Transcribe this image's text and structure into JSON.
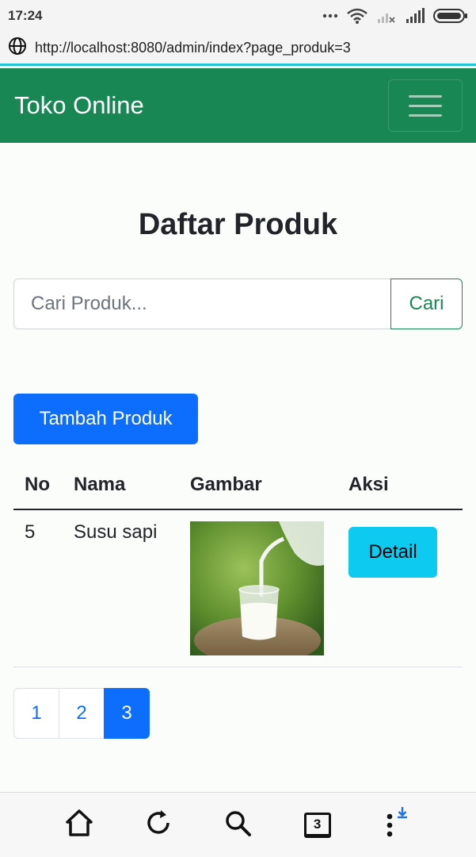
{
  "status_bar": {
    "time": "17:24"
  },
  "browser": {
    "url": "http://localhost:8080/admin/index?page_produk=3",
    "tab_count": "3"
  },
  "navbar": {
    "brand": "Toko Online"
  },
  "page": {
    "title": "Daftar Produk",
    "search": {
      "placeholder": "Cari Produk...",
      "value": "",
      "button_label": "Cari"
    },
    "add_button_label": "Tambah Produk",
    "table": {
      "headers": [
        "No",
        "Nama",
        "Gambar",
        "Aksi"
      ],
      "rows": [
        {
          "no": "5",
          "nama": "Susu sapi",
          "gambar": "milk-pouring-into-glass-image",
          "aksi_label": "Detail"
        }
      ]
    },
    "pagination": {
      "pages": [
        "1",
        "2",
        "3"
      ],
      "active": "3"
    }
  },
  "colors": {
    "navbar": "#198754",
    "primary": "#0d6efd",
    "info": "#0dcaf0",
    "url_accent": "#21c5d8"
  },
  "icons": {
    "bottom_bar": [
      "home-icon",
      "reload-icon",
      "search-icon",
      "tabs-icon",
      "menu-icon"
    ]
  }
}
